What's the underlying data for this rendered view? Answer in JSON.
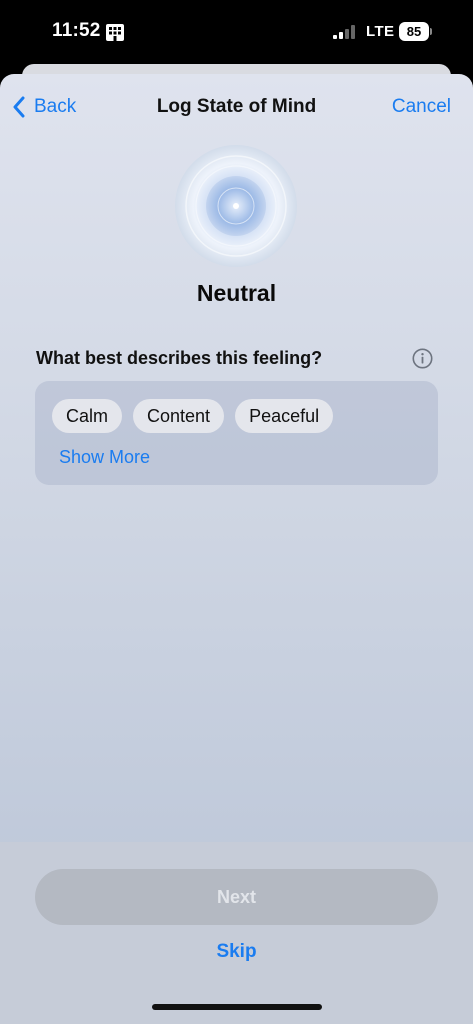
{
  "status_bar": {
    "time": "11:52",
    "network": "LTE",
    "battery_level": "85",
    "time_icon": "building-grid-icon",
    "signal_icon": "cellular-signal-icon"
  },
  "nav": {
    "back_label": "Back",
    "back_icon": "chevron-left-icon",
    "title": "Log State of Mind",
    "cancel_label": "Cancel"
  },
  "mood": {
    "label": "Neutral",
    "orb_icon": "mood-orb-icon"
  },
  "question": {
    "text": "What best describes this feeling?",
    "info_icon": "info-icon"
  },
  "tags": {
    "items": [
      "Calm",
      "Content",
      "Peaceful"
    ],
    "show_more_label": "Show More"
  },
  "footer": {
    "next_label": "Next",
    "skip_label": "Skip"
  },
  "colors": {
    "accent": "#1a7cf0",
    "disabled_button": "#b4b9c2"
  }
}
